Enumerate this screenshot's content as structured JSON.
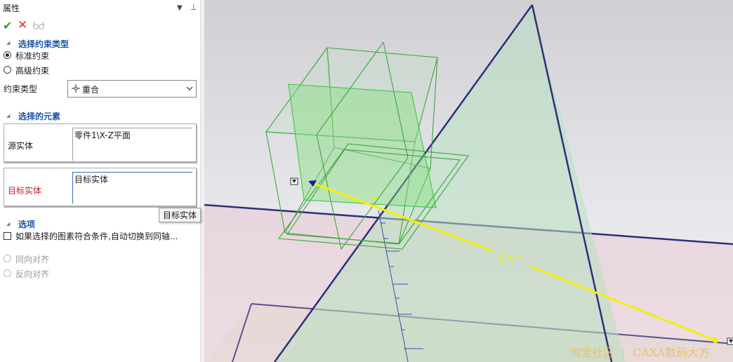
{
  "panel": {
    "title": "属性",
    "menu_icon": "dropdown-triangle-icon",
    "pin_icon": "pin-icon",
    "toolbar": {
      "ok_icon": "checkmark-icon",
      "cancel_icon": "close-icon",
      "preview_icon": "preview-glasses-icon"
    },
    "section_constraint_type": {
      "title": "选择约束类型",
      "options": [
        {
          "label": "标准约束",
          "selected": true
        },
        {
          "label": "高级约束",
          "selected": false
        }
      ],
      "type_label": "约束类型",
      "type_value": "重合",
      "type_icon": "coincident-icon"
    },
    "section_elements": {
      "title": "选择的元素",
      "source_label": "源实体",
      "source_value": "零件1\\X-Z平面",
      "target_label": "目标实体",
      "target_value": "目标实体",
      "target_color": "#c0202a",
      "tooltip": "目标实体"
    },
    "section_options": {
      "title": "选项",
      "checkbox_label": "如果选择的图素符合条件,自动切换到同轴...",
      "checkbox_checked": false,
      "align_options": [
        {
          "label": "同向对齐",
          "enabled": false
        },
        {
          "label": "反向对齐",
          "enabled": false
        }
      ]
    }
  },
  "viewport": {
    "cursor_label": "Cn *",
    "watermark": "淘宝社区 ｜ CAXA数码大方",
    "colors": {
      "plane_edge": "#2e2e7c",
      "box_edge": "#3aa83a",
      "constraint_line": "#f4f000",
      "axis": "#3a4fb0"
    }
  }
}
